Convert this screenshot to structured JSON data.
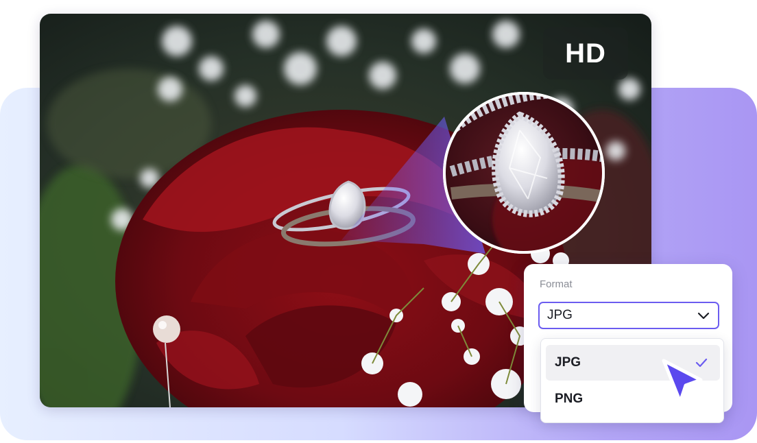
{
  "hero": {
    "badge_text": "HD",
    "image_subject": "diamond engagement ring on red rose with baby's breath flowers",
    "magnifier_icon": "zoom-lens"
  },
  "format_picker": {
    "label": "Format",
    "selected_value": "JPG",
    "chevron_icon": "chevron-down-icon",
    "options": [
      {
        "label": "JPG",
        "selected": true,
        "icon": "check-icon"
      },
      {
        "label": "PNG",
        "selected": false
      }
    ]
  },
  "pointer": {
    "icon": "cursor-arrow-icon"
  },
  "colors": {
    "accent": "#6b5cf0",
    "panel_gradient_start": "#e7efff",
    "panel_gradient_end": "#a996f3",
    "cursor_fill": "#5b49ee"
  }
}
